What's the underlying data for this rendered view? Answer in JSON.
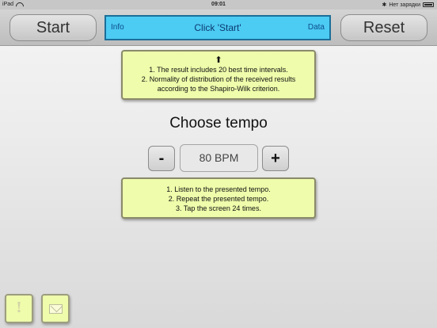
{
  "status_bar": {
    "device": "iPad",
    "time": "09:01",
    "charging": "Нет зарядки"
  },
  "toolbar": {
    "start_label": "Start",
    "reset_label": "Reset",
    "display": {
      "info_label": "Info",
      "message": "Click 'Start'",
      "data_label": "Data"
    }
  },
  "notes": {
    "top": {
      "arrow": "⬆",
      "lines": [
        "1. The result includes 20 best time intervals.",
        "2. Normality of distribution of the received results",
        "according to the Shapiro-Wilk criterion."
      ]
    },
    "bottom": {
      "lines": [
        "1. Listen to the presented tempo.",
        "2. Repeat the presented tempo.",
        "3. Tap the screen 24 times."
      ]
    }
  },
  "tempo": {
    "title": "Choose tempo",
    "minus_label": "-",
    "plus_label": "+",
    "value": "80 BPM"
  },
  "corner_buttons": {
    "info_glyph": "!"
  },
  "icons": {
    "wifi": "wifi-icon",
    "battery": "battery-icon",
    "bluetooth": "bluetooth-icon",
    "mail": "mail-icon"
  }
}
